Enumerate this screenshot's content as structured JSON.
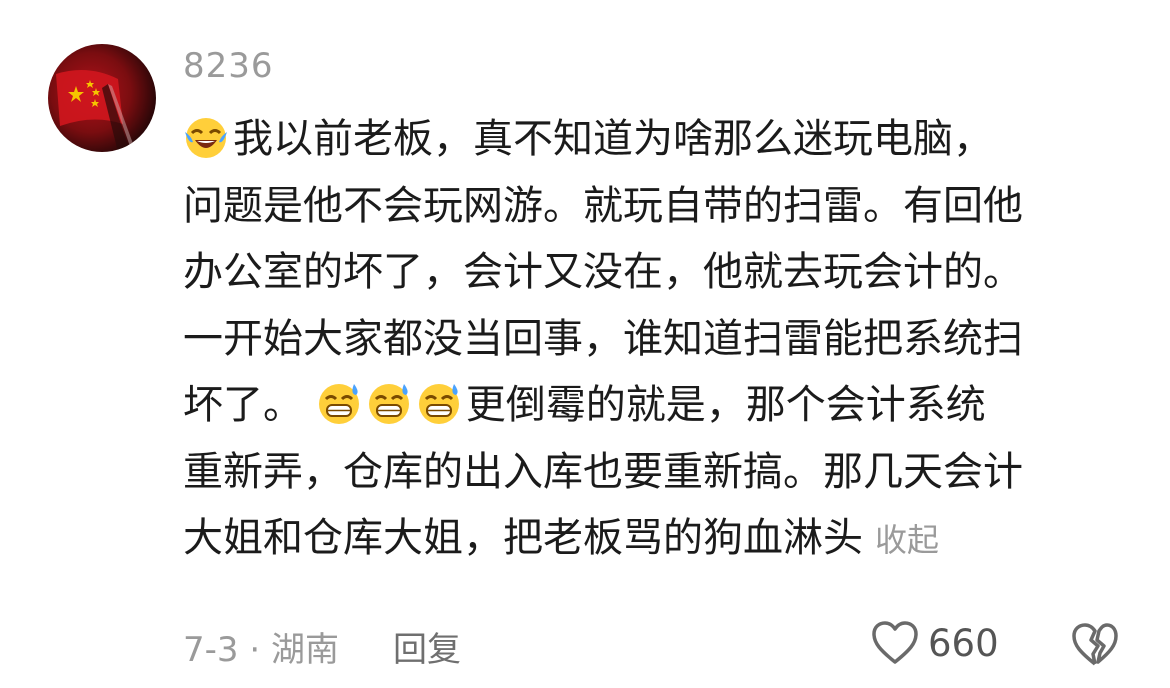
{
  "comment": {
    "username": "8236",
    "lines": [
      "我以前老板，真不知道为啥那么迷玩电脑，",
      "问题是他不会玩网游。就玩自带的扫雷。有回他",
      "办公室的坏了，会计又没在，他就去玩会计的。",
      "一开始大家都没当回事，谁知道扫雷能把系统扫",
      "坏了。",
      "更倒霉的就是，那个会计系统",
      "重新弄，仓库的出入库也要重新搞。那几天会计",
      "大姐和仓库大姐，把老板骂的狗血淋头"
    ],
    "collapse_label": "收起",
    "date_location": "7-3 · 湖南",
    "reply_label": "回复",
    "like_count": "660"
  },
  "icons": {
    "lead_emoji": "crying-laughing-emoji",
    "grin_emoji": "grinning-sweat-emoji",
    "like": "heart-outline-icon",
    "dislike": "broken-heart-icon"
  },
  "colors": {
    "meta_gray": "#9a9a9a",
    "text": "#1b1b1b"
  }
}
